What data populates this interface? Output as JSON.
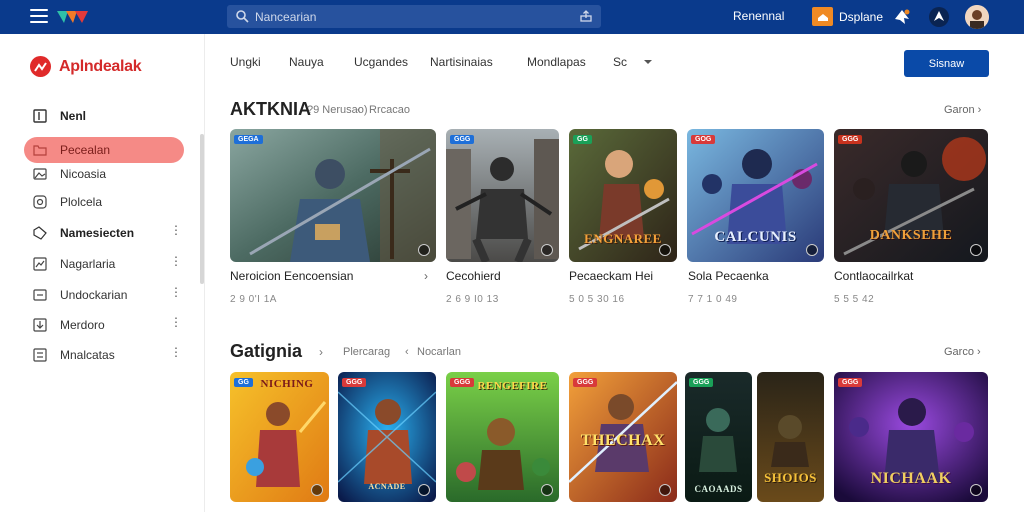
{
  "topbar": {
    "search_placeholder": "Nancearian",
    "link_label": "Renennal",
    "button_label": "Dsplane"
  },
  "sidebar": {
    "brand": "Aplndealak",
    "items": [
      {
        "label": "Nenl",
        "icon": "square-icon"
      },
      {
        "label": "Pecealan",
        "icon": "folder-icon"
      },
      {
        "label": "Nicoasia",
        "icon": "image-icon"
      },
      {
        "label": "Plolcela",
        "icon": "clock-icon"
      },
      {
        "label": "Namesiecten",
        "icon": "tag-icon"
      },
      {
        "label": "Nagarlaria",
        "icon": "chart-icon"
      },
      {
        "label": "Undockarian",
        "icon": "inbox-icon"
      },
      {
        "label": "Merdoro",
        "icon": "download-icon"
      },
      {
        "label": "Mnalcatas",
        "icon": "list-icon"
      }
    ]
  },
  "tabs": [
    "Ungki",
    "Nauya",
    "Ucgandes",
    "Nartisinaias",
    "Mondlapas",
    "Sc"
  ],
  "cta_label": "Sisnaw",
  "section1": {
    "title": "AKTKNIA",
    "meta1": "?9 Nerusao)",
    "meta2": "Rrcacao",
    "see_all": "Garon",
    "cards": [
      {
        "title": "Neroicion Eencoensian",
        "sub": "2 9 0'I 1A",
        "badge": "GEGA",
        "cover_text": ""
      },
      {
        "title": "Cecohierd",
        "sub": "2 6 9 I0 13",
        "badge": "GGG",
        "cover_text": ""
      },
      {
        "title": "Pecaeckam Hei",
        "sub": "5 0 5 30 16",
        "badge": "GG",
        "cover_text": "ENGNAREE"
      },
      {
        "title": "Sola Pecaenka",
        "sub": "7 7 1 0 49",
        "badge": "GOG",
        "cover_text": "CALCUNIS"
      },
      {
        "title": "Contlaocailrkat",
        "sub": "5 5 5 42",
        "badge": "GGG",
        "cover_text": "DANKSEHE"
      }
    ]
  },
  "section2": {
    "title": "Gatignia",
    "meta1": "Plercarag",
    "meta2": "Nocarlan",
    "see_all": "Garco",
    "cards": [
      {
        "badge": "GG",
        "cover_text": "NICHING"
      },
      {
        "badge": "GGG",
        "cover_text": "ACNADE"
      },
      {
        "badge": "GGG",
        "cover_text": "RENGEFIRE"
      },
      {
        "badge": "GGG",
        "cover_text": "THECHAX"
      },
      {
        "badge": "GGG",
        "cover_text": "CAOAADS"
      },
      {
        "badge": "",
        "cover_text": "SHOIOS"
      },
      {
        "badge": "GGG",
        "cover_text": "NICHAAK"
      }
    ]
  },
  "colors": {
    "topbar": "#0a3a8c",
    "accent": "#0a4aa8",
    "brand_red": "#d42a2a",
    "active_nav": "#f58a86",
    "orange": "#f08a24"
  }
}
